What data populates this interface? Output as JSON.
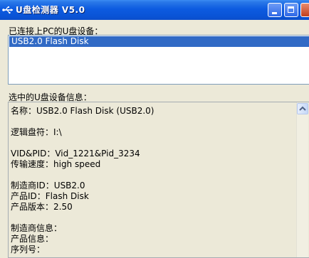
{
  "window": {
    "title": "U盘检测器 V5.0"
  },
  "connected_label": "已连接上PC的U盘设备：",
  "devices": [
    "USB2.0 Flash Disk"
  ],
  "info_label": "选中的U盘设备信息：",
  "info": {
    "name": "名称：USB2.0 Flash Disk  (USB2.0)",
    "drive": "逻辑盘符：I:\\",
    "vidpid": "VID&PID：Vid_1221&Pid_3234",
    "speed": "传输速度：high speed",
    "vendor_id": "制造商ID：USB2.0",
    "product_id": "产品ID：Flash Disk",
    "version": "产品版本：2.50",
    "vendor_info": "制造商信息：",
    "product_info": "产品信息：",
    "serial": "序列号："
  },
  "colors": {
    "selection": "#316AC5",
    "titlebar": "#0A54D6",
    "face": "#ECE9D8"
  }
}
